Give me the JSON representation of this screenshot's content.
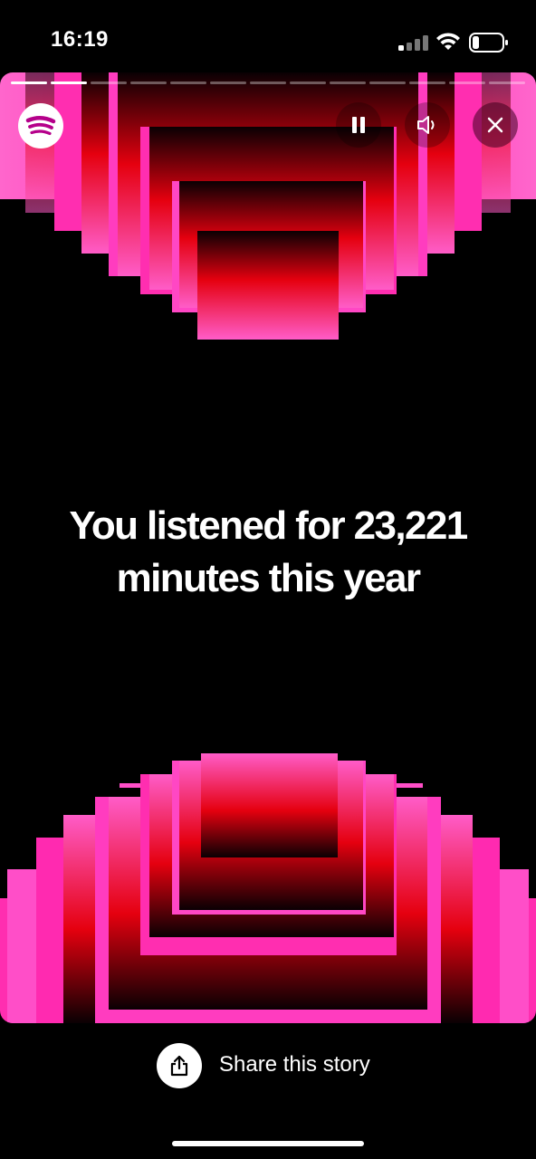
{
  "status_bar": {
    "time": "16:19"
  },
  "story": {
    "progress_total": 13,
    "progress_done": 2,
    "headline_line1": "You listened for 23,221",
    "headline_line2": "minutes this year"
  },
  "icons": {
    "logo": "spotify-logo",
    "pause": "pause-icon",
    "sound": "speaker-icon",
    "close": "close-icon",
    "share": "share-icon"
  },
  "colors": {
    "pink": "#ff4fc4",
    "magenta": "#ff1fa6",
    "red": "#ee0015",
    "dark_red": "#3a0008",
    "background": "#000000"
  },
  "share": {
    "label": "Share this story"
  }
}
